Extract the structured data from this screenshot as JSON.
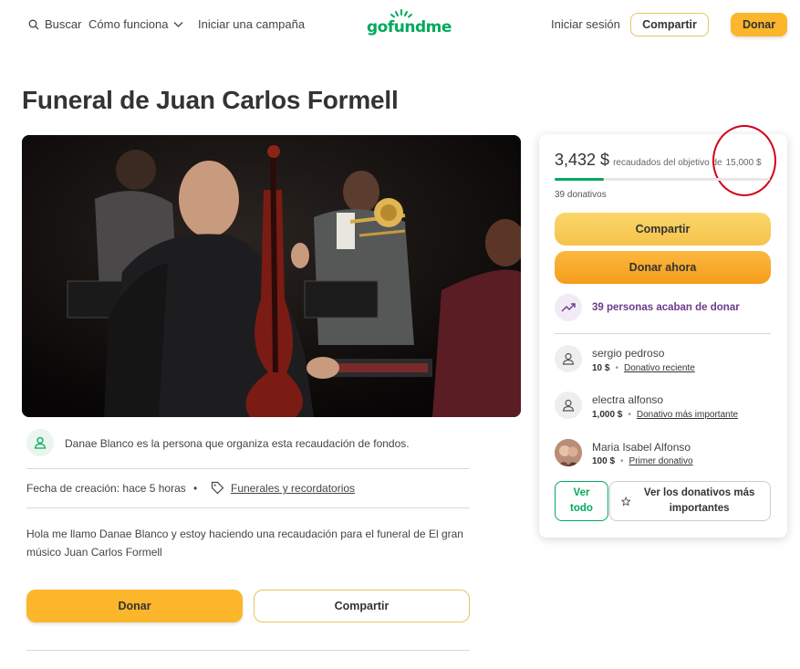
{
  "header": {
    "search_label": "Buscar",
    "how_it_works_label": "Cómo funciona",
    "start_campaign_label": "Iniciar una campaña",
    "logo_text": "gofundme",
    "sign_in_label": "Iniciar sesión",
    "share_label": "Compartir",
    "donate_label": "Donar"
  },
  "campaign": {
    "title": "Funeral de Juan Carlos Formell",
    "organizer_text": "Danae Blanco es la persona que organiza esta recaudación de fondos.",
    "created_label": "Fecha de creación: hace 5 horas",
    "category_label": "Funerales y recordatorios",
    "description": "Hola me llamo Danae Blanco y estoy haciendo una recaudación para el funeral de El gran músico Juan Carlos Formell",
    "donate_button": "Donar",
    "share_button": "Compartir"
  },
  "card": {
    "raised_amount": "3,432 $",
    "raised_text": "recaudados del objetivo de",
    "goal_amount": "15,000 $",
    "progress_fraction": 0.229,
    "donations_count": "39 donativos",
    "share_button": "Compartir",
    "donate_now_button": "Donar ahora",
    "recent_donors_text": "39 personas acaban de donar",
    "donors": [
      {
        "name": "sergio pedroso",
        "amount": "10 $",
        "tag": "Donativo reciente"
      },
      {
        "name": "electra alfonso",
        "amount": "1,000 $",
        "tag": "Donativo más importante"
      },
      {
        "name": "Maria Isabel Alfonso",
        "amount": "100 $",
        "tag": "Primer donativo"
      }
    ],
    "see_all_button": "Ver todo",
    "top_donations_button": "Ver los donativos más importantes"
  },
  "colors": {
    "brand_green": "#02a95c",
    "accent_yellow": "#fbb62c",
    "accent_orange": "#f7a21b",
    "annotation_red": "#d3001c"
  }
}
